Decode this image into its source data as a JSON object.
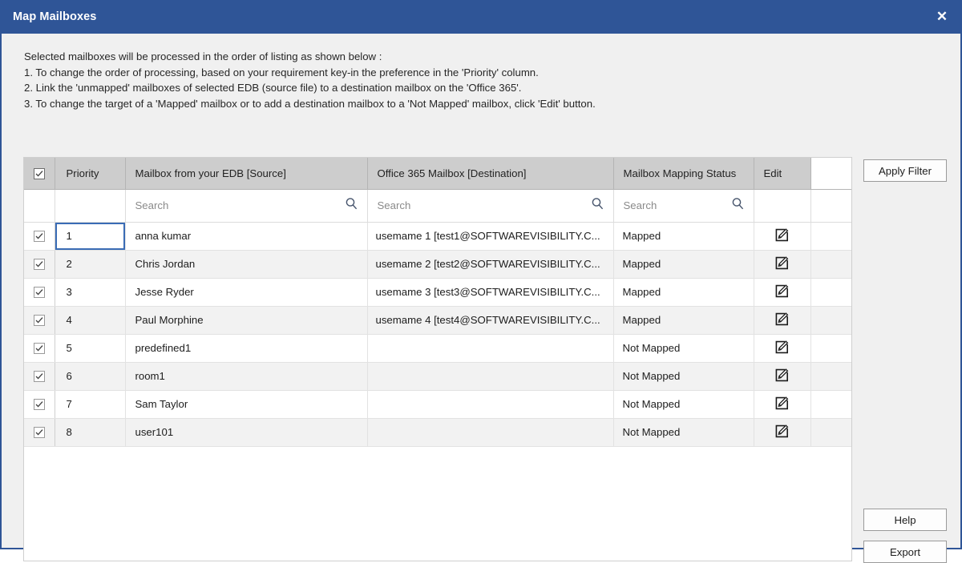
{
  "window": {
    "title": "Map Mailboxes",
    "close_icon": "close-icon",
    "close_glyph": "✕",
    "accent_color": "#2f5597"
  },
  "instructions": [
    "Selected mailboxes will be processed in the order of listing as shown below :",
    "1. To change the order of processing, based on your requirement key-in the preference in the 'Priority' column.",
    "2. Link the 'unmapped' mailboxes of selected EDB (source file) to a destination mailbox on the 'Office 365'.",
    "3. To change the target of a 'Mapped' mailbox or to add a destination mailbox to a 'Not Mapped' mailbox, click 'Edit' button."
  ],
  "grid": {
    "headers": {
      "select_all": "select-all-checkbox",
      "priority": "Priority",
      "source": "Mailbox from your EDB [Source]",
      "destination": "Office 365 Mailbox [Destination]",
      "status": "Mailbox Mapping Status",
      "edit": "Edit"
    },
    "search_placeholder": "Search",
    "search_values": {
      "source": "",
      "destination": "",
      "status": ""
    },
    "status_colors": {
      "mapped": "#3aa655",
      "not_mapped": "#e8443f"
    },
    "rows": [
      {
        "checked": true,
        "priority": "1",
        "source": "anna kumar",
        "destination": "usemame 1 [test1@SOFTWAREVISIBILITY.C...",
        "status": "Mapped",
        "mapped": true,
        "focused": true
      },
      {
        "checked": true,
        "priority": "2",
        "source": "Chris Jordan",
        "destination": "usemame 2 [test2@SOFTWAREVISIBILITY.C...",
        "status": "Mapped",
        "mapped": true,
        "focused": false
      },
      {
        "checked": true,
        "priority": "3",
        "source": "Jesse Ryder",
        "destination": "usemame 3 [test3@SOFTWAREVISIBILITY.C...",
        "status": "Mapped",
        "mapped": true,
        "focused": false
      },
      {
        "checked": true,
        "priority": "4",
        "source": "Paul Morphine",
        "destination": "usemame 4 [test4@SOFTWAREVISIBILITY.C...",
        "status": "Mapped",
        "mapped": true,
        "focused": false
      },
      {
        "checked": true,
        "priority": "5",
        "source": "predefined1",
        "destination": "",
        "status": "Not Mapped",
        "mapped": false,
        "focused": false
      },
      {
        "checked": true,
        "priority": "6",
        "source": "room1",
        "destination": "",
        "status": "Not Mapped",
        "mapped": false,
        "focused": false
      },
      {
        "checked": true,
        "priority": "7",
        "source": "Sam Taylor",
        "destination": "",
        "status": "Not Mapped",
        "mapped": false,
        "focused": false
      },
      {
        "checked": true,
        "priority": "8",
        "source": "user101",
        "destination": "",
        "status": "Not Mapped",
        "mapped": false,
        "focused": false
      }
    ]
  },
  "buttons": {
    "apply_filter": "Apply Filter",
    "help": "Help",
    "export": "Export"
  }
}
